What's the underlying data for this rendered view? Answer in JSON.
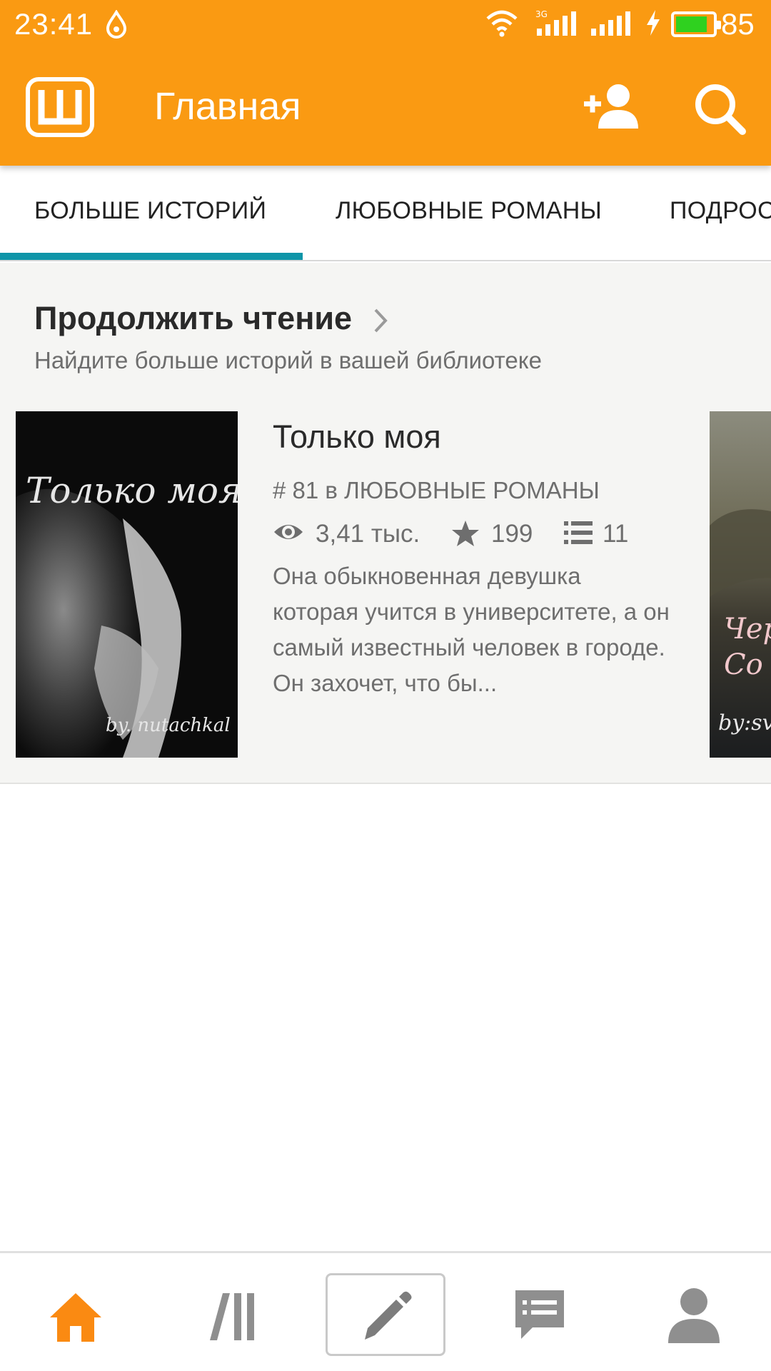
{
  "status_bar": {
    "time": "23:41",
    "network_label": "3G",
    "battery_percent": "85",
    "battery_level": 0.85,
    "battery_color": "#2fd11f"
  },
  "app_bar": {
    "title": "Главная",
    "logo_letter": "Ш",
    "background_color": "#fa9a12",
    "icons": [
      "logo-icon",
      "add-user-icon",
      "search-icon"
    ]
  },
  "tabs": {
    "items": [
      "БОЛЬШЕ ИСТОРИЙ",
      "ЛЮБОВНЫЕ РОМАНЫ",
      "ПОДРОС"
    ],
    "selected": 0,
    "indicator_color": "#0e95a8"
  },
  "continue_reading": {
    "title": "Продолжить чтение",
    "subtitle": "Найдите больше историй в вашей библиотеке",
    "story": {
      "title": "Только моя",
      "rank": "# 81 в ЛЮБОВНЫЕ РОМАНЫ",
      "reads": "3,41 тыс.",
      "votes": "199",
      "parts": "11",
      "description": "Она обыкновенная девушка которая учится в университете, а он самый известный человек в городе. Он захочет, что  бы...",
      "cover_title": "Только моя",
      "cover_author": "by. nutachkal"
    },
    "next_cover_text": [
      "Чер",
      "Co",
      "by:sv"
    ]
  },
  "bottom_nav": {
    "items": [
      "home-icon",
      "library-icon",
      "write-icon",
      "messages-icon",
      "profile-icon"
    ],
    "active": 0,
    "active_color": "#fa8a12",
    "inactive_color": "#8f8f8f"
  }
}
